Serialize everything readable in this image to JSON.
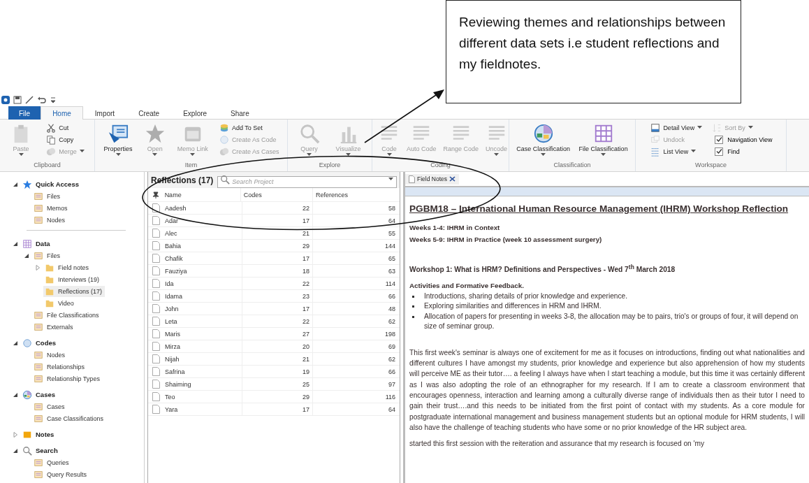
{
  "callout": {
    "text": "Reviewing themes and relationships between different data sets i.e student reflections and my fieldnotes."
  },
  "ribbon": {
    "tabs": [
      {
        "label": "File",
        "kind": "file",
        "selected": false
      },
      {
        "label": "Home",
        "kind": "tab",
        "selected": true
      },
      {
        "label": "Import",
        "kind": "tab",
        "selected": false
      },
      {
        "label": "Create",
        "kind": "tab",
        "selected": false
      },
      {
        "label": "Explore",
        "kind": "tab",
        "selected": false
      },
      {
        "label": "Share",
        "kind": "tab",
        "selected": false
      }
    ],
    "groups": [
      {
        "label": "Clipboard",
        "items": [
          {
            "label": "Paste",
            "kind": "large",
            "disabled": true,
            "dropdown": true
          },
          {
            "label": "Cut",
            "kind": "small",
            "disabled": false,
            "dropdown": false
          },
          {
            "label": "Copy",
            "kind": "small",
            "disabled": false,
            "dropdown": false
          },
          {
            "label": "Merge",
            "kind": "small",
            "disabled": true,
            "dropdown": true
          }
        ]
      },
      {
        "label": "Item",
        "items": [
          {
            "label": "Properties",
            "kind": "large",
            "disabled": false,
            "dropdown": true
          },
          {
            "label": "Open",
            "kind": "large",
            "disabled": true,
            "dropdown": true
          },
          {
            "label": "Memo Link",
            "kind": "large",
            "disabled": true,
            "dropdown": true
          },
          {
            "label": "Add To Set",
            "kind": "small",
            "disabled": false,
            "dropdown": false
          },
          {
            "label": "Create As Code",
            "kind": "small",
            "disabled": true,
            "dropdown": false
          },
          {
            "label": "Create As Cases",
            "kind": "small",
            "disabled": true,
            "dropdown": false
          }
        ]
      },
      {
        "label": "Explore",
        "items": [
          {
            "label": "Query",
            "kind": "large",
            "disabled": true,
            "dropdown": true
          },
          {
            "label": "Visualize",
            "kind": "large",
            "disabled": true,
            "dropdown": true
          }
        ]
      },
      {
        "label": "Coding",
        "items": [
          {
            "label": "Code",
            "kind": "large",
            "disabled": true,
            "dropdown": true
          },
          {
            "label": "Auto Code",
            "kind": "large",
            "disabled": true,
            "dropdown": false
          },
          {
            "label": "Range Code",
            "kind": "large",
            "disabled": true,
            "dropdown": false
          },
          {
            "label": "Uncode",
            "kind": "large",
            "disabled": true,
            "dropdown": true
          }
        ]
      },
      {
        "label": "Classification",
        "items": [
          {
            "label": "Case Classification",
            "kind": "large",
            "disabled": false,
            "dropdown": true
          },
          {
            "label": "File Classification",
            "kind": "large",
            "disabled": false,
            "dropdown": true
          }
        ]
      },
      {
        "label": "Workspace",
        "items": [
          {
            "label": "Detail View",
            "kind": "small",
            "disabled": false,
            "dropdown": true
          },
          {
            "label": "Undock",
            "kind": "small",
            "disabled": true,
            "dropdown": false
          },
          {
            "label": "List View",
            "kind": "small",
            "disabled": false,
            "dropdown": true
          },
          {
            "label": "Sort By",
            "kind": "small",
            "disabled": true,
            "dropdown": true
          },
          {
            "label": "Navigation View",
            "kind": "check",
            "checked": true
          },
          {
            "label": "Find",
            "kind": "check",
            "checked": true
          }
        ]
      }
    ]
  },
  "navigation": [
    {
      "label": "Quick Access",
      "expanded": true,
      "selected": false,
      "children": [
        {
          "label": "Files",
          "selected": false
        },
        {
          "label": "Memos",
          "selected": false
        },
        {
          "label": "Nodes",
          "selected": false
        }
      ]
    },
    {
      "label": "Data",
      "expanded": true,
      "selected": false,
      "children": [
        {
          "label": "Files",
          "expanded": true,
          "selected": false,
          "children": [
            {
              "label": "Field notes",
              "expanded": false,
              "selected": false
            },
            {
              "label": "Interviews (19)",
              "selected": false
            },
            {
              "label": "Reflections (17)",
              "selected": true
            },
            {
              "label": "Video",
              "selected": false
            }
          ]
        },
        {
          "label": "File Classifications",
          "selected": false
        },
        {
          "label": "Externals",
          "selected": false
        }
      ]
    },
    {
      "label": "Codes",
      "expanded": true,
      "selected": false,
      "children": [
        {
          "label": "Nodes",
          "selected": false
        },
        {
          "label": "Relationships",
          "selected": false
        },
        {
          "label": "Relationship Types",
          "selected": false
        }
      ]
    },
    {
      "label": "Cases",
      "expanded": true,
      "selected": false,
      "children": [
        {
          "label": "Cases",
          "selected": false
        },
        {
          "label": "Case Classifications",
          "selected": false
        }
      ]
    },
    {
      "label": "Notes",
      "expanded": false,
      "selected": false
    },
    {
      "label": "Search",
      "expanded": true,
      "selected": false,
      "children": [
        {
          "label": "Queries",
          "selected": false
        },
        {
          "label": "Query Results",
          "selected": false
        }
      ]
    }
  ],
  "list": {
    "title": "Reflections (17)",
    "search": {
      "placeholder": "Search Project"
    },
    "columns": [
      "Name",
      "Codes",
      "References"
    ],
    "rows": [
      [
        "Aadesh",
        "22",
        "58"
      ],
      [
        "Adar",
        "17",
        "64"
      ],
      [
        "Alec",
        "21",
        "55"
      ],
      [
        "Bahia",
        "29",
        "144"
      ],
      [
        "Chafik",
        "17",
        "65"
      ],
      [
        "Fauziya",
        "18",
        "63"
      ],
      [
        "Ida",
        "22",
        "114"
      ],
      [
        "Idama",
        "23",
        "66"
      ],
      [
        "John",
        "17",
        "48"
      ],
      [
        "Leta",
        "22",
        "62"
      ],
      [
        "Maris",
        "27",
        "198"
      ],
      [
        "Mirza",
        "20",
        "69"
      ],
      [
        "Nijah",
        "21",
        "62"
      ],
      [
        "Safrina",
        "19",
        "66"
      ],
      [
        "Shaiming",
        "25",
        "97"
      ],
      [
        "Teo",
        "29",
        "116"
      ],
      [
        "Yara",
        "17",
        "64"
      ]
    ]
  },
  "document": {
    "tab": "Field Notes",
    "blocks": [
      {
        "kind": "title",
        "text": "PGBM18 – International Human Resource Management (IHRM) Workshop Reflection"
      },
      {
        "kind": "bold",
        "text": "Weeks 1-4: IHRM in Context"
      },
      {
        "kind": "bold",
        "text": "Weeks 5-9: IHRM in Practice (week 10 assessment surgery)"
      },
      {
        "kind": "heading",
        "text": "Workshop 1: What is HRM? Definitions and Perspectives -  Wed 7$^{th}$ March 2018"
      },
      {
        "kind": "bold",
        "text": "Activities and Formative Feedback."
      },
      {
        "kind": "bullet",
        "text": "Introductions, sharing details of prior knowledge and experience."
      },
      {
        "kind": "bullet",
        "text": "Exploring similarities and differences in HRM and IHRM."
      },
      {
        "kind": "bullet",
        "text": "Allocation of papers for presenting in weeks 3-8, the allocation may be to pairs, trio's    or groups of four, it will depend on size of seminar group."
      },
      {
        "kind": "paragraph",
        "text": "This first week's seminar is always one of excitement for me as it focuses on introductions, finding out what nationalities and different cultures I have amongst my students, prior knowledge and experience but also apprehension of how my students will perceive ME as their tutor…. a feeling I always have when I start teaching a module, but this time it was certainly different as I was also adopting the role of an ethnographer for my research.   If I am to create a classroom environment that encourages openness, interaction and learning among a culturally diverse range of individuals then as their tutor I need to gain their trust….and this needs to be initiated from the first point of contact with my students.  As a core module for postgraduate international management and business management students but an optional module for HRM students, I will also have the challenge of teaching students who have some or no prior knowledge of the HR subject area."
      },
      {
        "kind": "paragraph",
        "text": "started this first session with the reiteration and assurance that my research is focused on 'my"
      }
    ]
  }
}
